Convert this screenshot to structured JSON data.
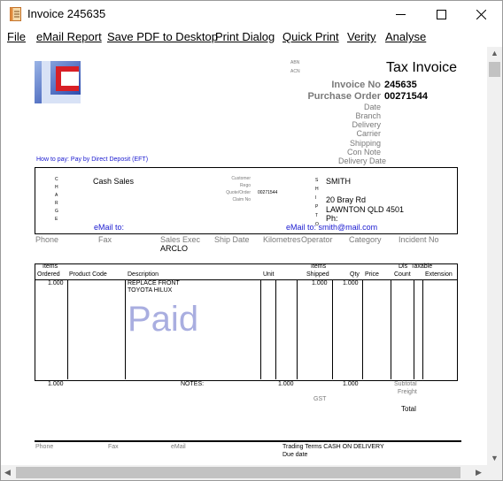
{
  "window": {
    "title": "Invoice 245635"
  },
  "menu": [
    "File",
    "eMail Report",
    "Save PDF to Desktop",
    "Print Dialog",
    "Quick Print",
    "Verity",
    "Analyse"
  ],
  "invoice": {
    "abn": "ABN",
    "acn": "ACN",
    "heading": "Tax Invoice",
    "invoice_no_label": "Invoice No",
    "invoice_no": "245635",
    "po_label": "Purchase Order",
    "po": "00271544",
    "fields": [
      "Date",
      "Branch",
      "Delivery",
      "Carrier",
      "Shipping",
      "Con Note",
      "Delivery Date"
    ],
    "how_to_pay": "How to pay: Pay by Direct Deposit (EFT)"
  },
  "charge_box": {
    "charge_letters": [
      "C",
      "H",
      "A",
      "R",
      "G",
      "E"
    ],
    "name": "Cash Sales",
    "mid_labels": [
      "Customer",
      "Rego",
      "Quote/Order",
      "Claim No"
    ],
    "quote_order_value": "00271544",
    "ship_letters": [
      "S",
      "H",
      "I",
      "P",
      "T",
      "O"
    ],
    "ship_name": "SMITH",
    "ship_addr1": "20 Bray Rd",
    "ship_addr2": "LAWNTON QLD 4501",
    "ship_ph": "Ph:",
    "email_left": "eMail to:",
    "email_right": "eMail to:  smith@mail.com"
  },
  "info_row": {
    "labels": [
      "Phone",
      "Fax",
      "Sales Exec",
      "Ship Date",
      "Kilometres",
      "Operator",
      "Category",
      "Incident No"
    ],
    "sales_exec": "ARCLO"
  },
  "items": {
    "headers": {
      "items_ordered_top": "Items",
      "items_ordered": "Ordered",
      "product_code": "Product Code",
      "description": "Description",
      "unit": "Unit",
      "items_shipped_top": "Items",
      "items_shipped": "Shipped",
      "qty": "Qty",
      "price": "Price",
      "dis_top": "Dis",
      "count": "Count",
      "taxable_top": "Taxable",
      "extension": "Extension"
    },
    "rows": [
      {
        "ordered": "1.000",
        "desc1": "REPLACE FRONT",
        "desc2": "TOYOTA HILUX",
        "shipped": "1.000",
        "qty": "1.000"
      }
    ],
    "watermark": "Paid"
  },
  "totals": {
    "ordered_total": "1.000",
    "notes": "NOTES:",
    "unit_total": "1.000",
    "qty_total": "1.000",
    "subtotal": "Subtotal",
    "freight": "Freight",
    "gst": "GST",
    "total": "Total"
  },
  "footer": {
    "phone": "Phone",
    "fax": "Fax",
    "email": "eMail",
    "trading_terms": "Trading Terms CASH ON DELIVERY",
    "due_date": "Due date"
  }
}
